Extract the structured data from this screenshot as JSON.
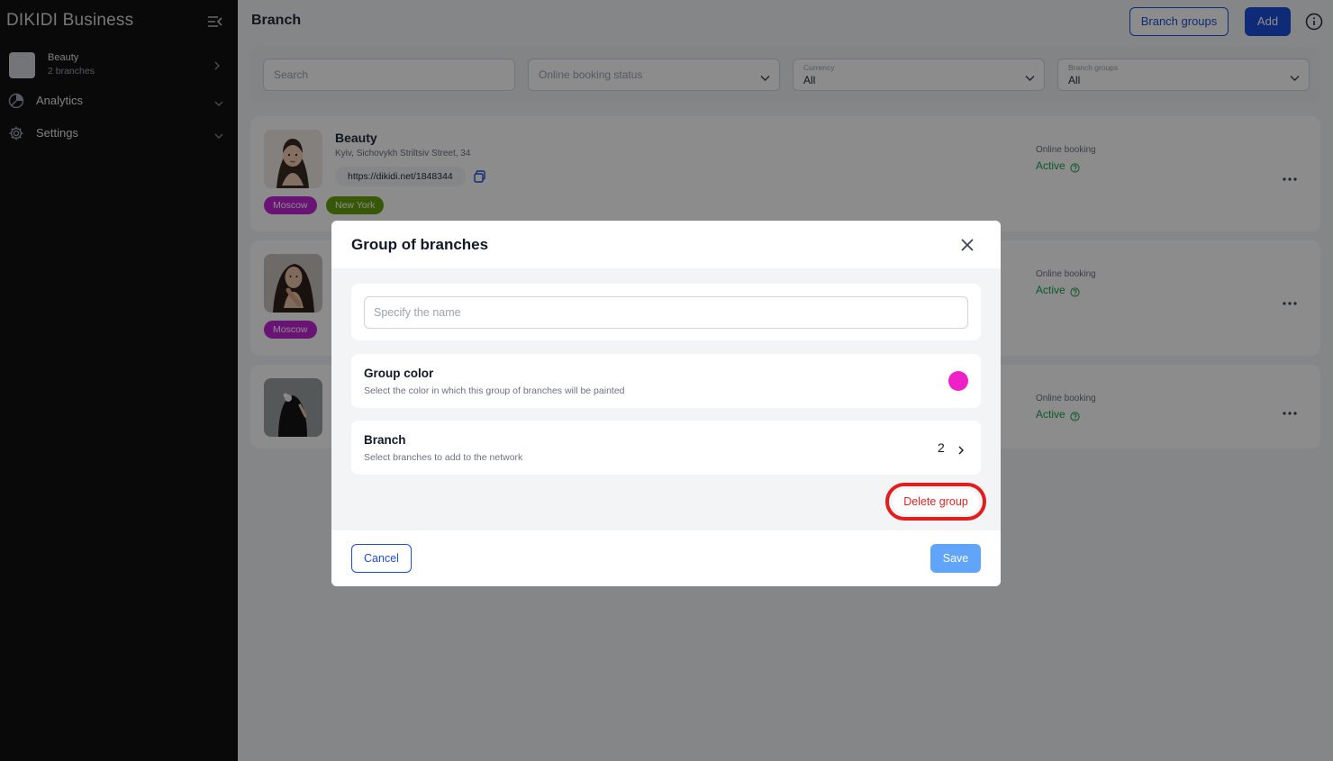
{
  "sidebar": {
    "brand": "DIKIDI Business",
    "account": {
      "name": "Beauty",
      "sub": "2 branches"
    },
    "items": [
      {
        "label": "Analytics"
      },
      {
        "label": "Settings"
      }
    ]
  },
  "header": {
    "title": "Branch",
    "branch_groups_label": "Branch groups",
    "add_label": "Add"
  },
  "filters": {
    "search_placeholder": "Search",
    "booking_status_placeholder": "Online booking status",
    "currency": {
      "caption": "Currency",
      "value": "All"
    },
    "branch_groups": {
      "caption": "Branch groups",
      "value": "All"
    }
  },
  "branches": [
    {
      "name": "Beauty",
      "address": "Kyiv, Sichovykh Striltsiv Street, 34",
      "link": "https://dikidi.net/1848344",
      "tags": [
        {
          "label": "Moscow",
          "color": "#c026d3"
        },
        {
          "label": "New York",
          "color": "#65a30d"
        }
      ],
      "booking_caption": "Online booking",
      "booking_status": "Active"
    },
    {
      "tags": [
        {
          "label": "Moscow",
          "color": "#c026d3"
        }
      ],
      "booking_caption": "Online booking",
      "booking_status": "Active"
    },
    {
      "booking_caption": "Online booking",
      "booking_status": "Active"
    }
  ],
  "modal": {
    "title": "Group of branches",
    "name_placeholder": "Specify the name",
    "color_section": {
      "title": "Group color",
      "subtitle": "Select the color in which this group of branches will be painted",
      "color": "#f020c8"
    },
    "branch_section": {
      "title": "Branch",
      "subtitle": "Select branches to add to the network",
      "count": "2"
    },
    "delete_label": "Delete group",
    "cancel_label": "Cancel",
    "save_label": "Save"
  },
  "colors": {
    "accent": "#1d4ed8",
    "danger": "#dc2626",
    "active": "#16a34a"
  }
}
